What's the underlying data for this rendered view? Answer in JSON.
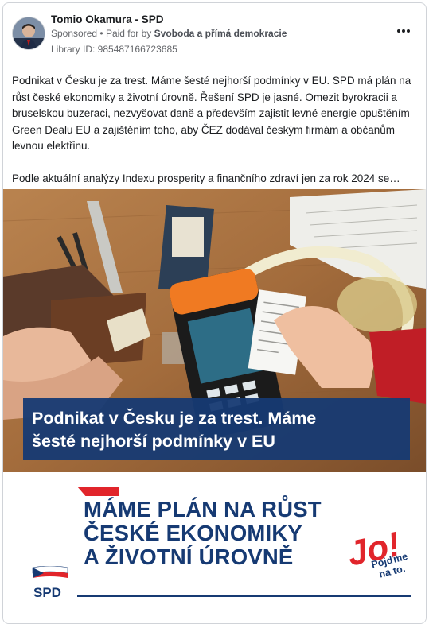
{
  "post": {
    "page_name": "Tomio Okamura - SPD",
    "sponsored_label": "Sponsored",
    "separator": "•",
    "paid_for_prefix": "Paid for by",
    "paid_for_by": "Svoboda a přímá demokracie",
    "library_id": "Library ID: 985487166723685",
    "more_icon": "more-horizontal-icon",
    "paragraph_1": "Podnikat v Česku je za trest. Máme šesté nejhorší podmínky v EU. SPD má plán na růst české ekonomiky a životní úrovně. Řešení SPD je jasné. Omezit byrokracii a bruselskou buzeraci, nezvyšovat daně a především zajistit levné energie opuštěním Green Dealu EU a zajištěním toho, aby ČEZ dodával českým firmám a občanům levnou elektřinu.",
    "paragraph_2": "Podle aktuální analýzy Indexu prosperity a finančního zdraví jen za rok 2024 se…"
  },
  "creative": {
    "headline": "Podnikat v Česku je za trest. Máme\nšesté nejhorší podmínky v EU",
    "slogan": "MÁME PLÁN NA RŮST\nČESKÉ EKONOMIKY\nA ŽIVOTNÍ ÚROVNĚ",
    "party_logo_text": "SPD",
    "jo_mark": "Jo!",
    "jo_tagline": "Pojďme\nna to.",
    "colors": {
      "navy": "#163a73",
      "red": "#e1252b"
    }
  }
}
